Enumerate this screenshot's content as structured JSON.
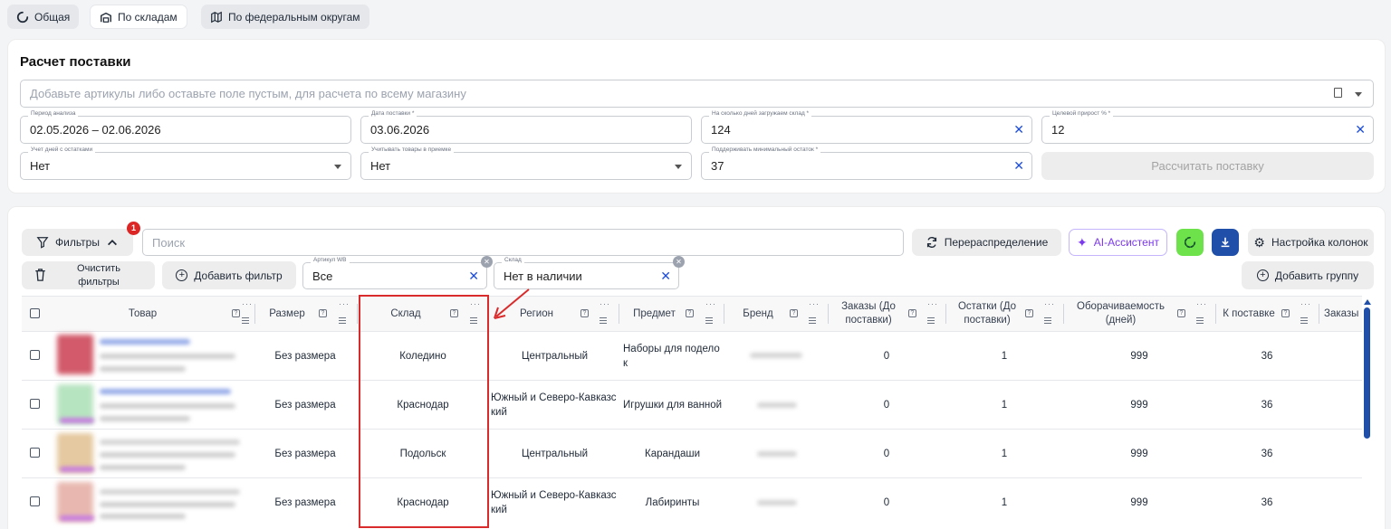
{
  "tabs": [
    {
      "label": "Общая",
      "icon": "loading-circle-icon"
    },
    {
      "label": "По складам",
      "icon": "warehouse-icon"
    },
    {
      "label": "По федеральным округам",
      "icon": "map-icon"
    }
  ],
  "supply": {
    "title": "Расчет поставки",
    "articles_placeholder": "Добавьте артикулы либо оставьте поле пустым, для расчета по всему магазину",
    "fields": [
      {
        "label": "Период анализа",
        "value": "02.05.2026 – 02.06.2026"
      },
      {
        "label": "Дата поставки *",
        "value": "03.06.2026"
      },
      {
        "label": "На сколько дней загружаем склад *",
        "value": "124"
      },
      {
        "label": "Целевой прирост % *",
        "value": "12"
      },
      {
        "label": "Учет дней с остатками",
        "value": "Нет"
      },
      {
        "label": "Учитывать товары в приемке",
        "value": "Нет"
      },
      {
        "label": "Поддерживать минимальный остаток *",
        "value": "37"
      }
    ],
    "calc_button": "Рассчитать поставку"
  },
  "toolbar": {
    "filters_label": "Фильтры",
    "filters_badge": "1",
    "search_placeholder": "Поиск",
    "redistribution": "Перераспределение",
    "ai_assistant": "AI-Ассистент",
    "columns_settings": "Настройка колонок",
    "clear_filters": "Очистить фильтры",
    "add_filter": "Добавить фильтр",
    "add_group": "Добавить группу",
    "chip_article": {
      "label": "Артикул WB",
      "value": "Все"
    },
    "chip_warehouse": {
      "label": "Склад",
      "value": "Нет в наличии"
    }
  },
  "table": {
    "headers": [
      "Товар",
      "Размер",
      "Склад",
      "Регион",
      "Предмет",
      "Бренд",
      "Заказы (До поставки)",
      "Остатки (До поставки)",
      "Оборачиваемость (дней)",
      "К поставке",
      "Заказы"
    ],
    "rows": [
      {
        "size": "Без размера",
        "warehouse": "Коледино",
        "region": "Центральный",
        "subject": "Наборы для поделок",
        "orders": "0",
        "stock": "1",
        "turnover": "999",
        "to_supply": "36"
      },
      {
        "size": "Без размера",
        "warehouse": "Краснодар",
        "region": "Южный и Северо-Кавказский",
        "subject": "Игрушки для ванной",
        "orders": "0",
        "stock": "1",
        "turnover": "999",
        "to_supply": "36"
      },
      {
        "size": "Без размера",
        "warehouse": "Подольск",
        "region": "Центральный",
        "subject": "Карандаши",
        "orders": "0",
        "stock": "1",
        "turnover": "999",
        "to_supply": "36"
      },
      {
        "size": "Без размера",
        "warehouse": "Краснодар",
        "region": "Южный и Северо-Кавказский",
        "subject": "Лабиринты",
        "orders": "0",
        "stock": "1",
        "turnover": "999",
        "to_supply": "36"
      }
    ]
  },
  "colors": {
    "accent": "#1d4ed8",
    "highlight": "#d92b2b",
    "green": "#6ee24a",
    "blue_btn": "#1f4fa8"
  }
}
